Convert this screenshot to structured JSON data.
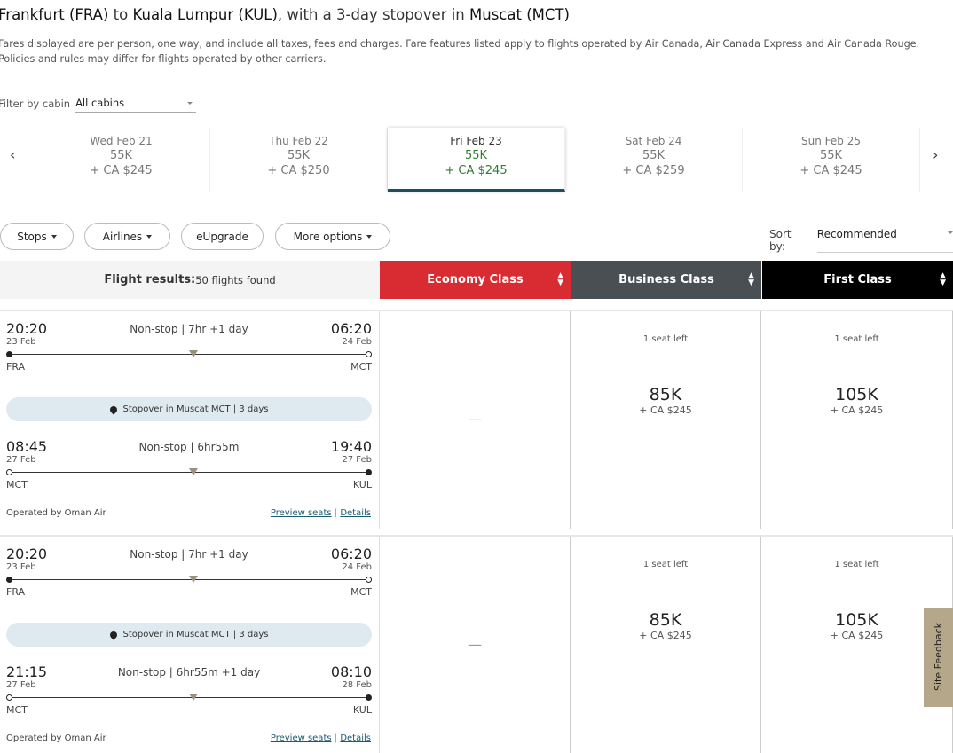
{
  "title": {
    "from": "Frankfurt (FRA)",
    "to_word": " to ",
    "to": "Kuala Lumpur (KUL)",
    "mid": ", with a 3-day stopover in ",
    "stop": "Muscat (MCT)"
  },
  "disclaimer": "Fares displayed are per person, one way, and include all taxes, fees and charges. Fare features listed apply to flights operated by Air Canada, Air Canada Express and Air Canada Rouge. Policies and rules may differ for flights operated by other carriers.",
  "filter": {
    "label": "Filter by cabin",
    "value": "All cabins"
  },
  "dates": [
    {
      "day": "Wed Feb 21",
      "points": "55K",
      "cash": "+ CA $245"
    },
    {
      "day": "Thu Feb 22",
      "points": "55K",
      "cash": "+ CA $250"
    },
    {
      "day": "Fri Feb 23",
      "points": "55K",
      "cash": "+ CA $245",
      "selected": true
    },
    {
      "day": "Sat Feb 24",
      "points": "55K",
      "cash": "+ CA $259"
    },
    {
      "day": "Sun Feb 25",
      "points": "55K",
      "cash": "+ CA $245"
    }
  ],
  "pills": {
    "stops": "Stops",
    "airlines": "Airlines",
    "eupgrade": "eUpgrade",
    "more": "More options"
  },
  "sort": {
    "label": "Sort by:",
    "value": "Recommended"
  },
  "results": {
    "label": "Flight results:",
    "count": "50 flights found"
  },
  "cabins": {
    "economy": "Economy Class",
    "business": "Business Class",
    "first": "First Class",
    "colors": {
      "economy": "#d82c32",
      "business": "#4a4f54",
      "first": "#000000"
    }
  },
  "flights": [
    {
      "seg1": {
        "dep": "20:20",
        "dep_date": "23 Feb",
        "info": "Non-stop | 7hr +1 day",
        "arr": "06:20",
        "arr_date": "24 Feb",
        "from": "FRA",
        "to": "MCT"
      },
      "stopover": "Stopover in Muscat MCT | 3 days",
      "seg2": {
        "dep": "08:45",
        "dep_date": "27 Feb",
        "info": "Non-stop | 6hr55m",
        "arr": "19:40",
        "arr_date": "27 Feb",
        "from": "MCT",
        "to": "KUL"
      },
      "operator": "Operated by Oman Air",
      "preview": "Preview seats",
      "details": "Details",
      "economy": "—",
      "business": {
        "seats": "1 seat left",
        "points": "85K",
        "cash": "+ CA $245"
      },
      "first": {
        "seats": "1 seat left",
        "points": "105K",
        "cash": "+ CA $245"
      }
    },
    {
      "seg1": {
        "dep": "20:20",
        "dep_date": "23 Feb",
        "info": "Non-stop | 7hr +1 day",
        "arr": "06:20",
        "arr_date": "24 Feb",
        "from": "FRA",
        "to": "MCT"
      },
      "stopover": "Stopover in Muscat MCT | 3 days",
      "seg2": {
        "dep": "21:15",
        "dep_date": "27 Feb",
        "info": "Non-stop | 6hr55m +1 day",
        "arr": "08:10",
        "arr_date": "28 Feb",
        "from": "MCT",
        "to": "KUL"
      },
      "operator": "Operated by Oman Air",
      "preview": "Preview seats",
      "details": "Details",
      "economy": "—",
      "business": {
        "seats": "1 seat left",
        "points": "85K",
        "cash": "+ CA $245"
      },
      "first": {
        "seats": "1 seat left",
        "points": "105K",
        "cash": "+ CA $245"
      }
    }
  ],
  "feedback": "Site Feedback"
}
